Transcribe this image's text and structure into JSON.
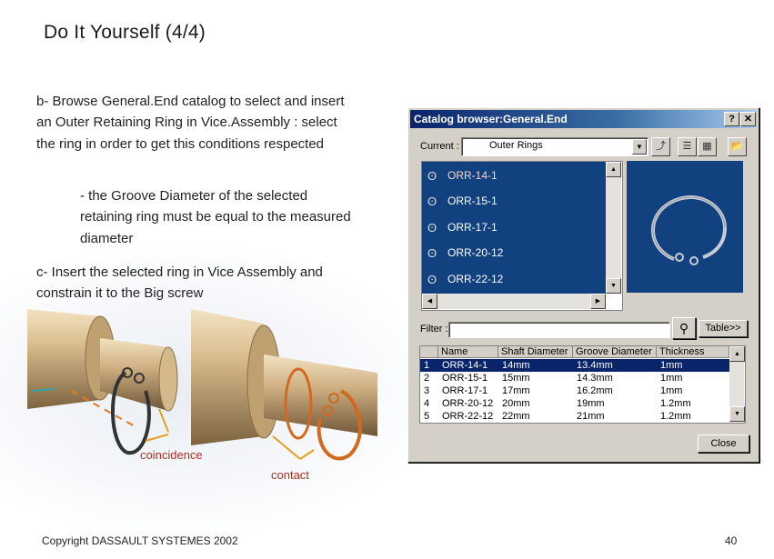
{
  "slide": {
    "title": "Do It Yourself (4/4)",
    "para_b": "b- Browse General.End catalog to select and insert an Outer Retaining Ring in Vice.Assembly : select the ring in order to get this conditions respected",
    "para_b_sub": "- the Groove Diameter of the selected retaining ring must be equal to the measured diameter",
    "para_c": "c- Insert the selected ring in Vice Assembly and constrain it to the Big screw",
    "label_coincidence": "coincidence",
    "label_contact": "contact",
    "copyright": "Copyright DASSAULT SYSTEMES 2002",
    "page_number": "40"
  },
  "dialog": {
    "title": "Catalog browser:General.End",
    "help_label": "?",
    "close_label": "✕",
    "current_label": "Current :",
    "current_value": "Outer Rings",
    "items": [
      {
        "label": "ORR-14-1"
      },
      {
        "label": "ORR-15-1"
      },
      {
        "label": "ORR-17-1"
      },
      {
        "label": "ORR-20-12"
      },
      {
        "label": "ORR-22-12"
      }
    ],
    "filter_label": "Filter :",
    "filter_value": "",
    "table_button": "Table>>",
    "close_button": "Close",
    "table": {
      "columns": [
        "Name",
        "Shaft Diameter",
        "Groove Diameter",
        "Thickness"
      ],
      "rows": [
        {
          "index": "1",
          "name": "ORR-14-1",
          "shaft": "14mm",
          "groove": "13.4mm",
          "thickness": "1mm"
        },
        {
          "index": "2",
          "name": "ORR-15-1",
          "shaft": "15mm",
          "groove": "14.3mm",
          "thickness": "1mm"
        },
        {
          "index": "3",
          "name": "ORR-17-1",
          "shaft": "17mm",
          "groove": "16.2mm",
          "thickness": "1mm"
        },
        {
          "index": "4",
          "name": "ORR-20-12",
          "shaft": "20mm",
          "groove": "19mm",
          "thickness": "1.2mm"
        },
        {
          "index": "5",
          "name": "ORR-22-12",
          "shaft": "22mm",
          "groove": "21mm",
          "thickness": "1.2mm"
        }
      ]
    }
  },
  "colors": {
    "ring": "#333333",
    "ring_orange": "#d2691e",
    "shaft": "#c9ad84",
    "list_bg": "#11417f",
    "title_bar": "#0a246a"
  }
}
